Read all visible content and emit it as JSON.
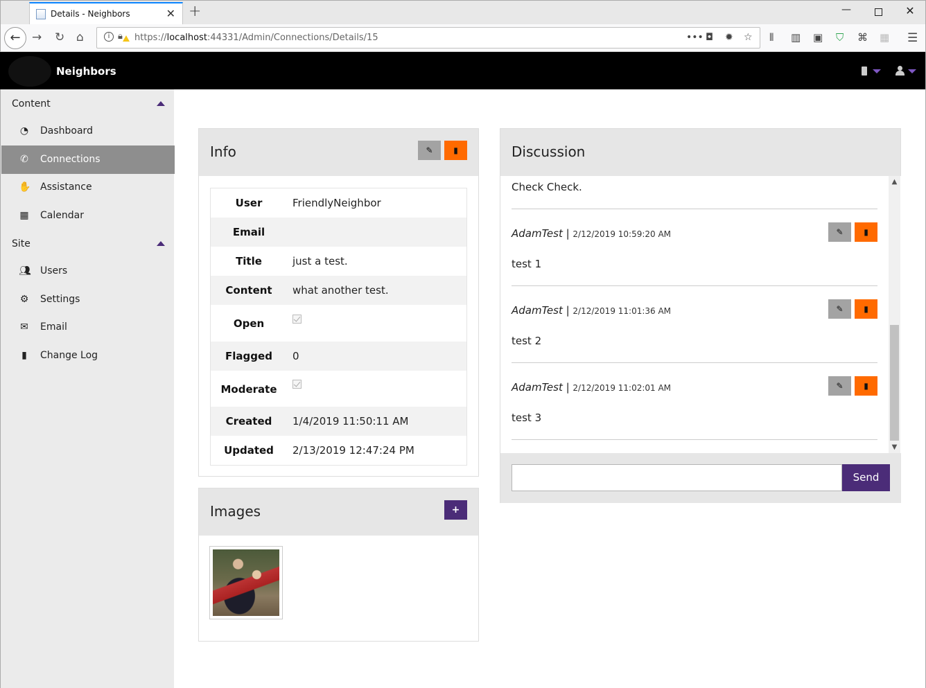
{
  "browser": {
    "tab_title": "Details - Neighbors",
    "new_tab": "+",
    "url_scheme": "https://",
    "url_host": "localhost",
    "url_path": ":44331/Admin/Connections/Details/15"
  },
  "app": {
    "brand": "Neighbors"
  },
  "sidebar": {
    "sections": [
      {
        "label": "Content",
        "items": [
          {
            "label": "Dashboard",
            "icon": "dashboard-icon"
          },
          {
            "label": "Connections",
            "icon": "phone-icon",
            "active": true
          },
          {
            "label": "Assistance",
            "icon": "handshake-icon"
          },
          {
            "label": "Calendar",
            "icon": "calendar-icon"
          }
        ]
      },
      {
        "label": "Site",
        "items": [
          {
            "label": "Users",
            "icon": "users-icon"
          },
          {
            "label": "Settings",
            "icon": "gears-icon"
          },
          {
            "label": "Email",
            "icon": "envelope-icon"
          },
          {
            "label": "Change Log",
            "icon": "file-icon"
          }
        ]
      }
    ]
  },
  "info": {
    "title": "Info",
    "rows": [
      {
        "key": "User",
        "value": "FriendlyNeighbor"
      },
      {
        "key": "Email",
        "value": ""
      },
      {
        "key": "Title",
        "value": "just a test."
      },
      {
        "key": "Content",
        "value": "what another test."
      },
      {
        "key": "Open",
        "value": "",
        "checkbox": true
      },
      {
        "key": "Flagged",
        "value": "0"
      },
      {
        "key": "Moderate",
        "value": "",
        "checkbox": true
      },
      {
        "key": "Created",
        "value": "1/4/2019 11:50:11 AM"
      },
      {
        "key": "Updated",
        "value": "2/13/2019 12:47:24 PM"
      }
    ]
  },
  "images": {
    "title": "Images",
    "add_label": "+"
  },
  "discussion": {
    "title": "Discussion",
    "first_text": "Check Check.",
    "messages": [
      {
        "author": "AdamTest",
        "sep": " | ",
        "date": "2/12/2019 10:59:20 AM",
        "text": "test 1"
      },
      {
        "author": "AdamTest",
        "sep": " | ",
        "date": "2/12/2019 11:01:36 AM",
        "text": "test 2"
      },
      {
        "author": "AdamTest",
        "sep": " | ",
        "date": "2/12/2019 11:02:01 AM",
        "text": "test 3"
      }
    ],
    "input_value": "",
    "send_label": "Send"
  },
  "colors": {
    "accent": "#4b2c78",
    "danger": "#ff6a00",
    "header": "#000000"
  }
}
